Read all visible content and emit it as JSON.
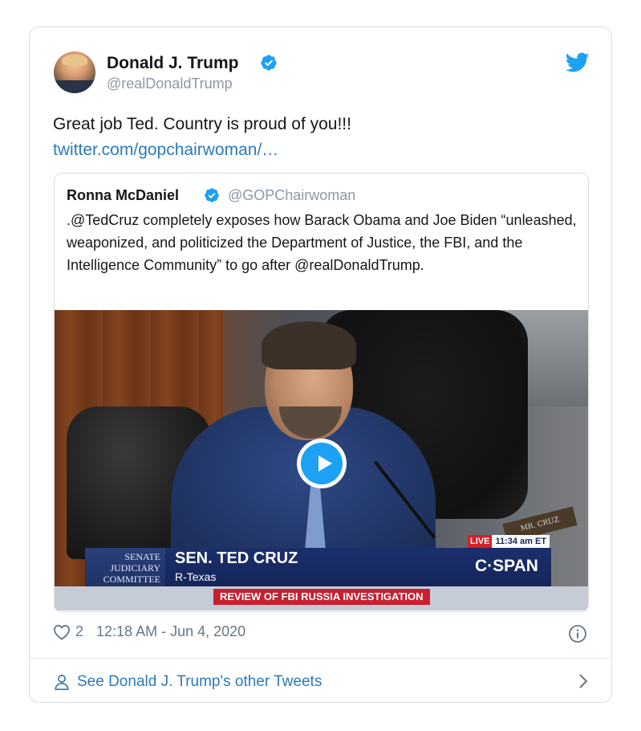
{
  "tweet": {
    "author": {
      "display_name": "Donald J. Trump",
      "handle": "@realDonaldTrump",
      "verified": true
    },
    "text": "Great job Ted. Country is proud of you!!!",
    "link": "twitter.com/gopchairwoman/…",
    "quoted": {
      "display_name": "Ronna McDaniel",
      "handle": "@GOPChairwoman",
      "verified": true,
      "text": ".@TedCruz completely exposes how Barack Obama and Joe Biden “unleashed, weaponized, and politicized the Department of Justice, the FBI, and the Intelligence Community” to go after @realDonaldTrump.",
      "video": {
        "caption_committee": "SENATE JUDICIARY COMMITTEE",
        "caption_name": "SEN. TED CRUZ",
        "caption_sub": "R-Texas",
        "live_label": "LIVE",
        "time_label": "11:34 am ET",
        "network": "C·SPAN",
        "banner": "REVIEW OF FBI RUSSIA INVESTIGATION",
        "nameplate": "MR. CRUZ"
      }
    },
    "likes": "2",
    "timestamp": "12:18 AM - Jun 4, 2020",
    "footer_link": "See Donald J. Trump's other Tweets"
  },
  "colors": {
    "twitter_blue": "#1da1f2",
    "link": "#2b7bb9",
    "muted": "#657786"
  }
}
